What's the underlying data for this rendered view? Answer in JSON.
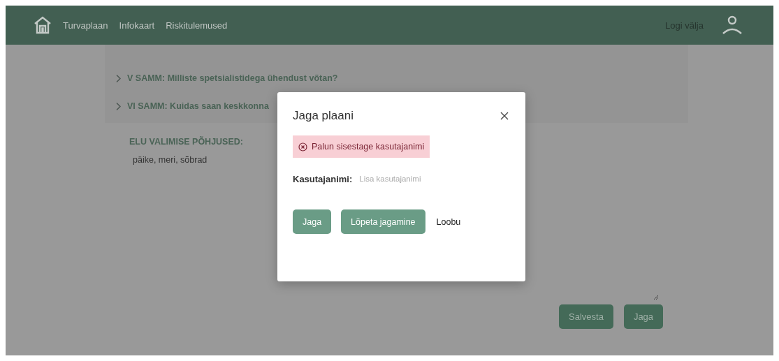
{
  "header": {
    "nav": [
      {
        "label": "Turvaplaan"
      },
      {
        "label": "Infokaart"
      },
      {
        "label": "Riskitulemused"
      }
    ],
    "logout": "Logi välja"
  },
  "steps": [
    {
      "label": "V SAMM: Milliste spetsialistidega ühendust võtan?",
      "expanded": false
    },
    {
      "label": "VI SAMM: Kuidas saan keskkonna",
      "expanded": false
    }
  ],
  "reasons": {
    "heading": "ELU VALIMISE PÕHJUSED:",
    "text": "päike, meri, sõbrad"
  },
  "actions": [
    "Salvesta",
    "Jaga"
  ],
  "modal": {
    "title": "Jaga plaani",
    "error": "Palun sisestage kasutajanimi",
    "field_label": "Kasutajanimi:",
    "placeholder": "Lisa kasutajanimi",
    "buttons": [
      {
        "label": "Jaga",
        "kind": "primary"
      },
      {
        "label": "Lõpeta jagamine",
        "kind": "primary"
      },
      {
        "label": "Loobu",
        "kind": "link"
      }
    ]
  }
}
